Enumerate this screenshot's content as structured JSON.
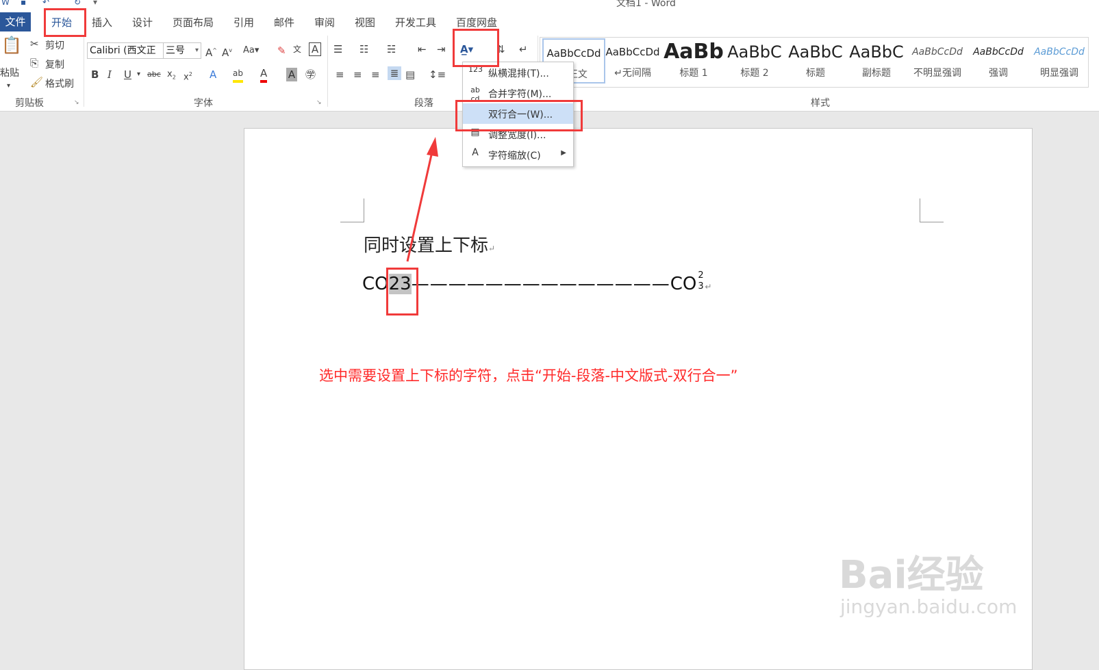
{
  "window": {
    "title": "文档1 - Word"
  },
  "tabs": [
    "文件",
    "开始",
    "插入",
    "设计",
    "页面布局",
    "引用",
    "邮件",
    "审阅",
    "视图",
    "开发工具",
    "百度网盘"
  ],
  "clipboard": {
    "paste": "粘贴",
    "cut": "剪切",
    "copy": "复制",
    "format_painter": "格式刷",
    "group_label": "剪贴板"
  },
  "font": {
    "name": "Calibri (西文正",
    "size": "三号",
    "group_label": "字体",
    "case_label": "Aa"
  },
  "paragraph": {
    "group_label": "段落"
  },
  "styles": {
    "group_label": "样式",
    "items": [
      {
        "sample": "AaBbCcDd",
        "name": "↵正文"
      },
      {
        "sample": "AaBbCcDd",
        "name": "↵无间隔"
      },
      {
        "sample": "AaBb",
        "name": "标题 1"
      },
      {
        "sample": "AaBbC",
        "name": "标题 2"
      },
      {
        "sample": "AaBbC",
        "name": "标题"
      },
      {
        "sample": "AaBbC",
        "name": "副标题"
      },
      {
        "sample": "AaBbCcDd",
        "name": "不明显强调"
      },
      {
        "sample": "AaBbCcDd",
        "name": "强调"
      },
      {
        "sample": "AaBbCcDd",
        "name": "明显强调"
      }
    ]
  },
  "dropdown_menu": {
    "items": [
      {
        "icon": "123",
        "label": "纵横混排(T)..."
      },
      {
        "icon": "ab cd",
        "label": "合并字符(M)..."
      },
      {
        "icon": "",
        "label": "双行合一(W)..."
      },
      {
        "icon": "▤",
        "label": "调整宽度(I)..."
      },
      {
        "icon": "A",
        "label": "字符缩放(C)"
      }
    ]
  },
  "document": {
    "line1": "同时设置上下标",
    "line2_prefix": "CO",
    "line2_selected": "23",
    "line2_dashes": "——————————————",
    "line2_formula": "CO",
    "sup": "2",
    "sub": "3",
    "instruction": "选中需要设置上下标的字符，点击“开始-段落-中文版式-双行合一”"
  },
  "watermark": {
    "brand": "Bai经验",
    "url": "jingyan.baidu.com"
  },
  "colors": {
    "accent": "#2b579a",
    "annotation": "#f03a3a",
    "highlight": "#cde0f7"
  }
}
